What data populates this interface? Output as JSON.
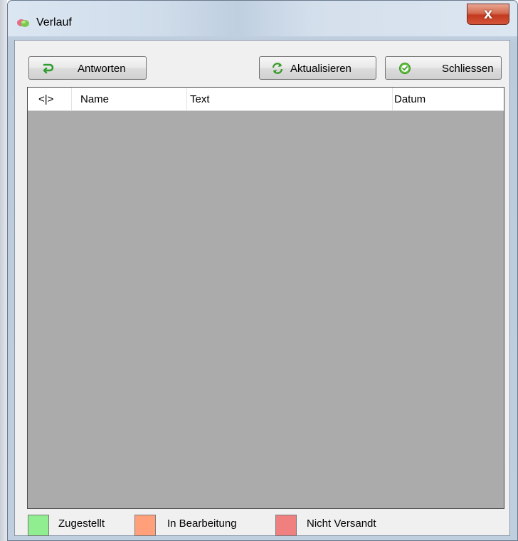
{
  "window": {
    "title": "Verlauf",
    "close_glyph": "X",
    "app_icon": "history-bubbles-icon"
  },
  "toolbar": {
    "reply_label": "Antworten",
    "reply_icon": "reply-arrow-icon",
    "refresh_label": "Aktualisieren",
    "refresh_icon": "refresh-icon",
    "close_label": "Schliessen",
    "close_icon": "checkmark-circle-icon"
  },
  "list": {
    "columns": [
      {
        "label": "<|>"
      },
      {
        "label": "Name"
      },
      {
        "label": "Text"
      },
      {
        "label": "Datum"
      }
    ],
    "rows": [],
    "background": "#ababab"
  },
  "legend": [
    {
      "label": "Zugestellt",
      "color": "#90ee90"
    },
    {
      "label": "In Bearbeitung",
      "color": "#ffa07a"
    },
    {
      "label": "Nicht Versandt",
      "color": "#f08080"
    }
  ],
  "colors": {
    "close_button": "#c2391e",
    "client_background": "#f0f0f0"
  }
}
